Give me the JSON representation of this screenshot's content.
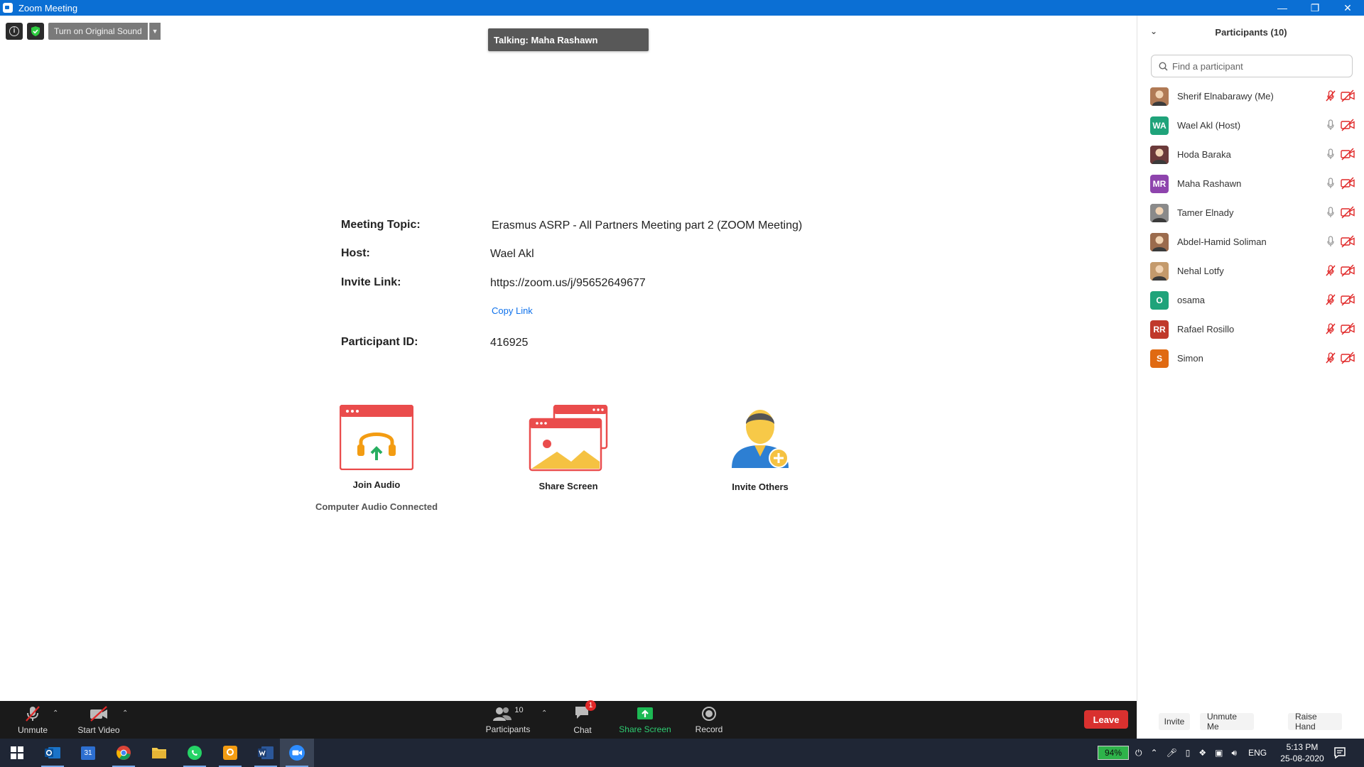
{
  "window": {
    "title": "Zoom Meeting"
  },
  "top_controls": {
    "original_sound_label": "Turn on Original Sound"
  },
  "talking_banner": "Talking: Maha Rashawn",
  "meeting_info": {
    "topic_label": "Meeting Topic:",
    "topic_value": "Erasmus ASRP - All Partners Meeting part 2 (ZOOM Meeting)",
    "host_label": "Host:",
    "host_value": "Wael Akl",
    "invite_label": "Invite Link:",
    "invite_value": "https://zoom.us/j/95652649677",
    "copy_link_label": "Copy Link",
    "participant_id_label": "Participant ID:",
    "participant_id_value": "416925"
  },
  "actions": {
    "join_audio_label": "Join Audio",
    "join_audio_status": "Computer Audio Connected",
    "share_screen_label": "Share Screen",
    "invite_others_label": "Invite Others"
  },
  "toolbar": {
    "unmute_label": "Unmute",
    "start_video_label": "Start Video",
    "participants_label": "Participants",
    "participants_count": "10",
    "chat_label": "Chat",
    "chat_badge": "1",
    "share_screen_label": "Share Screen",
    "record_label": "Record",
    "leave_label": "Leave"
  },
  "panel": {
    "title": "Participants (10)",
    "search_placeholder": "Find a participant",
    "participants": [
      {
        "name": "Sherif Elnabarawy (Me)",
        "initials": "",
        "avatar_color": "#b07a55",
        "photo": true,
        "mic": "muted",
        "video": "off"
      },
      {
        "name": "Wael Akl (Host)",
        "initials": "WA",
        "avatar_color": "#1fa37a",
        "photo": false,
        "mic": "on",
        "video": "off"
      },
      {
        "name": "Hoda Baraka",
        "initials": "",
        "avatar_color": "#6b3a3a",
        "photo": true,
        "mic": "on",
        "video": "off"
      },
      {
        "name": "Maha Rashawn",
        "initials": "MR",
        "avatar_color": "#8e44ad",
        "photo": false,
        "mic": "on",
        "video": "off"
      },
      {
        "name": "Tamer Elnady",
        "initials": "",
        "avatar_color": "#8a8a8a",
        "photo": true,
        "mic": "on",
        "video": "off"
      },
      {
        "name": "Abdel-Hamid Soliman",
        "initials": "",
        "avatar_color": "#9b6b4d",
        "photo": true,
        "mic": "on",
        "video": "off"
      },
      {
        "name": "Nehal Lotfy",
        "initials": "",
        "avatar_color": "#c49a6c",
        "photo": true,
        "mic": "muted",
        "video": "off"
      },
      {
        "name": "osama",
        "initials": "O",
        "avatar_color": "#1fa37a",
        "photo": false,
        "mic": "muted",
        "video": "off"
      },
      {
        "name": "Rafael Rosillo",
        "initials": "RR",
        "avatar_color": "#c0392b",
        "photo": false,
        "mic": "muted",
        "video": "off"
      },
      {
        "name": "Simon",
        "initials": "S",
        "avatar_color": "#e06a12",
        "photo": false,
        "mic": "muted",
        "video": "off"
      }
    ],
    "invite_label": "Invite",
    "unmute_me_label": "Unmute Me",
    "raise_hand_label": "Raise Hand"
  },
  "taskbar": {
    "battery": "94%",
    "language": "ENG",
    "time": "5:13 PM",
    "date": "25-08-2020",
    "calendar_day": "31"
  },
  "colors": {
    "zoom_blue": "#0e71eb",
    "leave_red": "#d9312f",
    "share_green": "#00c853",
    "muted_red": "#e02828"
  }
}
